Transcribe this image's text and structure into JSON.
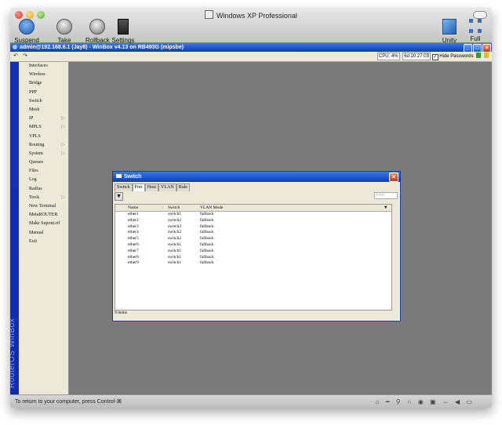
{
  "window": {
    "title": "Windows XP Professional",
    "toolbar": {
      "suspend": "Suspend",
      "snapshot": "Take Snapshot",
      "rollback": "Rollback",
      "settings": "Settings",
      "unity": "Unity",
      "fullscreen": "Full Screen"
    }
  },
  "winbox": {
    "title": "admin@192.168.6.1 (Jay8) - WinBox v4.13 on RB493G (mipsbe)",
    "cpu": "CPU: 4%",
    "uptime": "6d 20:27:03",
    "hide_passwords": "Hide Passwords",
    "brand": "RouterOS WinBox",
    "menu": [
      {
        "label": "Interfaces",
        "arrow": ""
      },
      {
        "label": "Wireless",
        "arrow": ""
      },
      {
        "label": "Bridge",
        "arrow": ""
      },
      {
        "label": "PPP",
        "arrow": ""
      },
      {
        "label": "Switch",
        "arrow": ""
      },
      {
        "label": "Mesh",
        "arrow": ""
      },
      {
        "label": "IP",
        "arrow": "▷"
      },
      {
        "label": "MPLS",
        "arrow": "▷"
      },
      {
        "label": "VPLS",
        "arrow": ""
      },
      {
        "label": "Routing",
        "arrow": "▷"
      },
      {
        "label": "System",
        "arrow": "▷"
      },
      {
        "label": "Queues",
        "arrow": ""
      },
      {
        "label": "Files",
        "arrow": ""
      },
      {
        "label": "Log",
        "arrow": ""
      },
      {
        "label": "Radius",
        "arrow": ""
      },
      {
        "label": "Tools",
        "arrow": "▷"
      },
      {
        "label": "New Terminal",
        "arrow": ""
      },
      {
        "label": "MetaROUTER",
        "arrow": ""
      },
      {
        "label": "Make Supout.rif",
        "arrow": ""
      },
      {
        "label": "Manual",
        "arrow": ""
      },
      {
        "label": "Exit",
        "arrow": ""
      }
    ]
  },
  "switch_dialog": {
    "title": "Switch",
    "tabs": [
      "Switch",
      "Port",
      "Host",
      "VLAN",
      "Rule"
    ],
    "active_tab": "Port",
    "find_placeholder": "Find",
    "columns": [
      "Name",
      "Switch",
      "VLAN Mode"
    ],
    "rows": [
      {
        "name": "ether1",
        "switch": "switch1",
        "vlan_mode": "fallback"
      },
      {
        "name": "ether2",
        "switch": "switch2",
        "vlan_mode": "fallback"
      },
      {
        "name": "ether3",
        "switch": "switch2",
        "vlan_mode": "fallback"
      },
      {
        "name": "ether4",
        "switch": "switch2",
        "vlan_mode": "fallback"
      },
      {
        "name": "ether5",
        "switch": "switch2",
        "vlan_mode": "fallback"
      },
      {
        "name": "ether6",
        "switch": "switch1",
        "vlan_mode": "fallback"
      },
      {
        "name": "ether7",
        "switch": "switch1",
        "vlan_mode": "fallback"
      },
      {
        "name": "ether8",
        "switch": "switch1",
        "vlan_mode": "fallback"
      },
      {
        "name": "ether9",
        "switch": "switch1",
        "vlan_mode": "fallback"
      }
    ],
    "status": "9 items"
  },
  "bottom_message": "To return to your computer, press Control-⌘"
}
